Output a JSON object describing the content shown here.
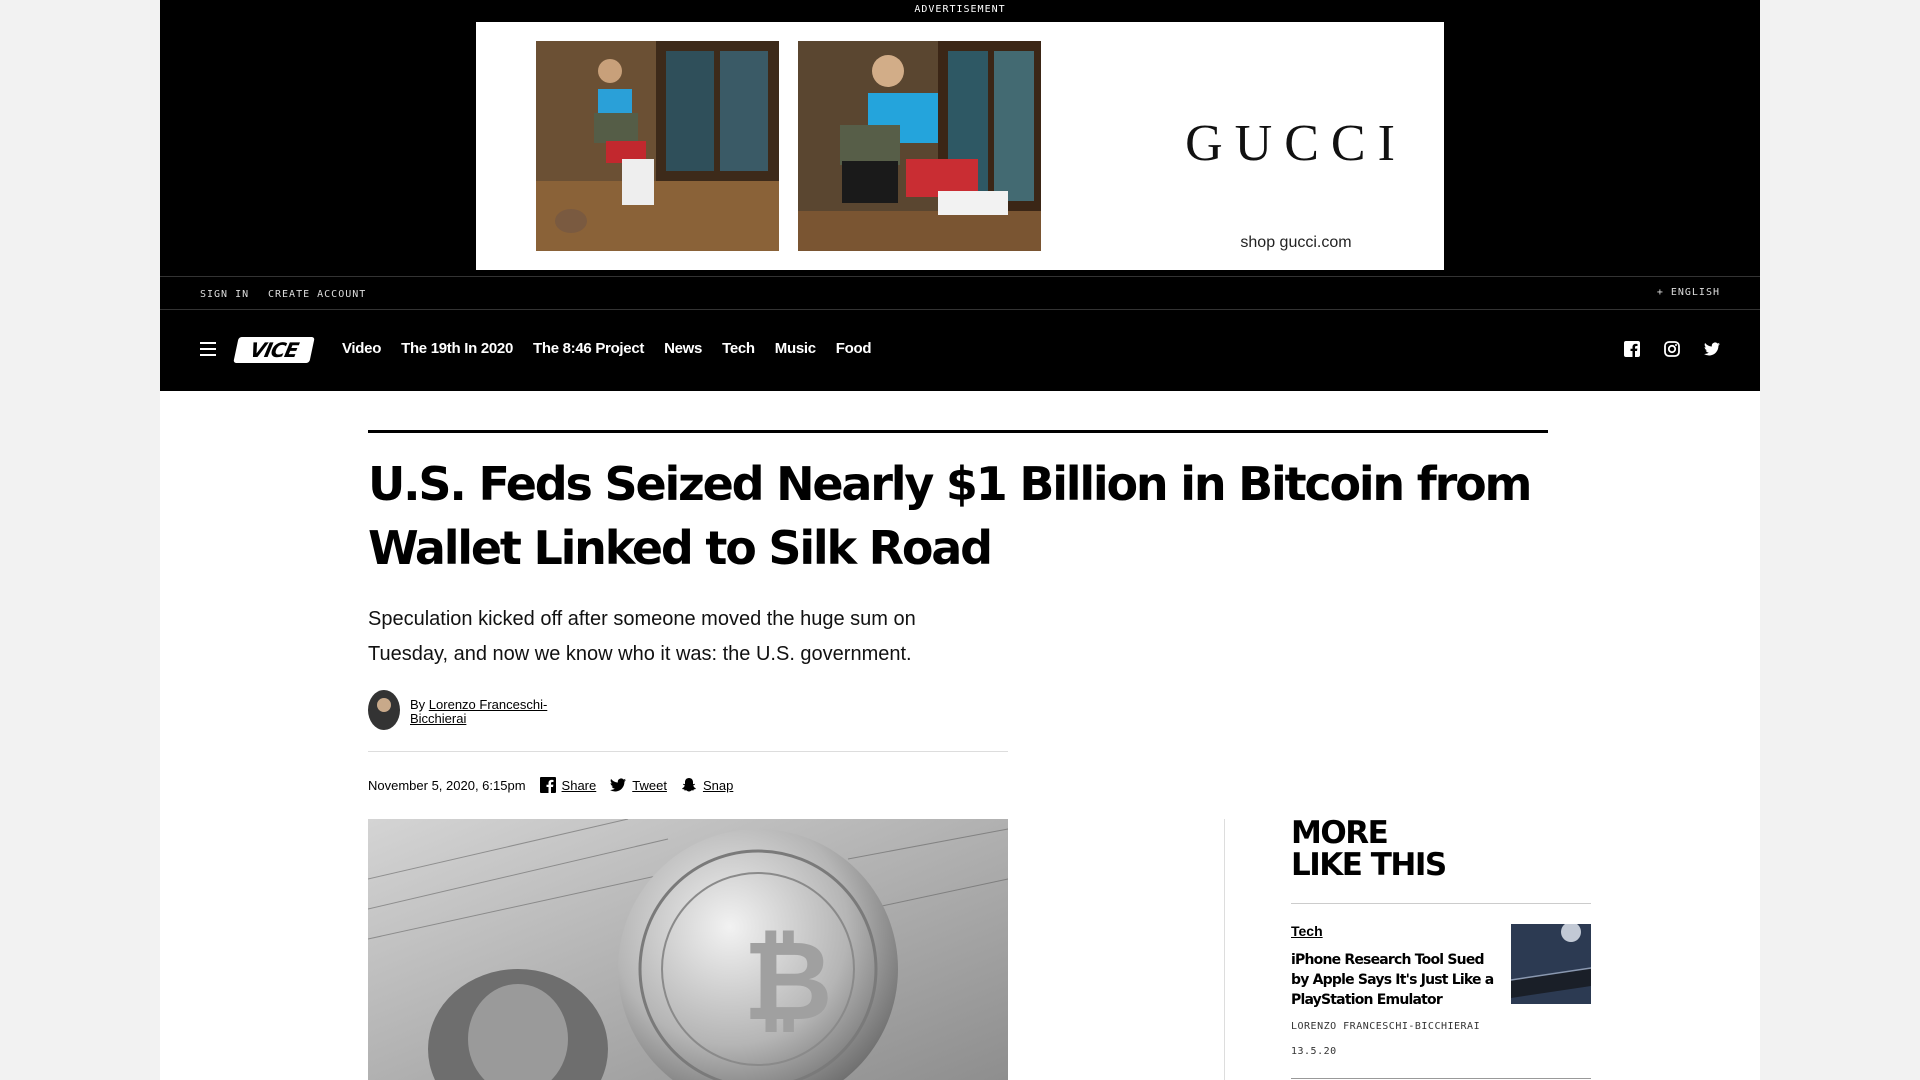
{
  "ad": {
    "label": "ADVERTISEMENT",
    "brand": "GUCCI",
    "cta": "shop gucci.com"
  },
  "utility": {
    "sign_in": "SIGN IN",
    "create_account": "CREATE ACCOUNT",
    "language": "+ ENGLISH"
  },
  "nav": {
    "logo": "VICE",
    "links": [
      "Video",
      "The 19th In 2020",
      "The 8:46 Project",
      "News",
      "Tech",
      "Music",
      "Food"
    ]
  },
  "article": {
    "headline": "U.S. Feds Seized Nearly $1 Billion in Bitcoin from Wallet Linked to Silk Road",
    "dek": "Speculation kicked off after someone moved the huge sum on Tuesday, and now we know who it was: the U.S. government.",
    "by_prefix": "By",
    "author": "Lorenzo Franceschi-Bicchierai",
    "date": "November 5, 2020, 6:15pm",
    "share": "Share",
    "tweet": "Tweet",
    "snap": "Snap"
  },
  "sidebar": {
    "heading_line1": "MORE",
    "heading_line2": "LIKE THIS",
    "card": {
      "category": "Tech",
      "title": "iPhone Research Tool Sued by Apple Says It's Just Like a PlayStation Emulator",
      "author": "LORENZO FRANCESCHI-BICCHIERAI",
      "date": "13.5.20"
    }
  }
}
